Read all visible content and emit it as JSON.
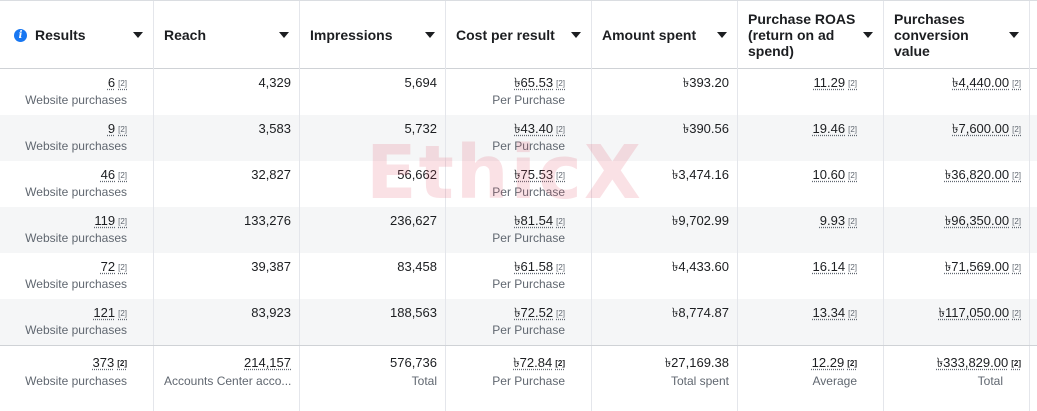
{
  "columns": [
    {
      "key": "results",
      "label": "Results"
    },
    {
      "key": "reach",
      "label": "Reach"
    },
    {
      "key": "impressions",
      "label": "Impressions"
    },
    {
      "key": "cost",
      "label": "Cost per result"
    },
    {
      "key": "spent",
      "label": "Amount spent"
    },
    {
      "key": "roas",
      "label": "Purchase ROAS (return on ad spend)"
    },
    {
      "key": "conv",
      "label": "Purchases conversion value"
    }
  ],
  "footnote": "[2]",
  "rows": [
    {
      "results": "6",
      "results_sub": "Website purchases",
      "reach": "4,329",
      "impressions": "5,694",
      "cost": "৳65.53",
      "cost_sub": "Per Purchase",
      "spent": "৳393.20",
      "roas": "11.29",
      "conv": "৳4,440.00"
    },
    {
      "results": "9",
      "results_sub": "Website purchases",
      "reach": "3,583",
      "impressions": "5,732",
      "cost": "৳43.40",
      "cost_sub": "Per Purchase",
      "spent": "৳390.56",
      "roas": "19.46",
      "conv": "৳7,600.00"
    },
    {
      "results": "46",
      "results_sub": "Website purchases",
      "reach": "32,827",
      "impressions": "56,662",
      "cost": "৳75.53",
      "cost_sub": "Per Purchase",
      "spent": "৳3,474.16",
      "roas": "10.60",
      "conv": "৳36,820.00"
    },
    {
      "results": "119",
      "results_sub": "Website purchases",
      "reach": "133,276",
      "impressions": "236,627",
      "cost": "৳81.54",
      "cost_sub": "Per Purchase",
      "spent": "৳9,702.99",
      "roas": "9.93",
      "conv": "৳96,350.00"
    },
    {
      "results": "72",
      "results_sub": "Website purchases",
      "reach": "39,387",
      "impressions": "83,458",
      "cost": "৳61.58",
      "cost_sub": "Per Purchase",
      "spent": "৳4,433.60",
      "roas": "16.14",
      "conv": "৳71,569.00"
    },
    {
      "results": "121",
      "results_sub": "Website purchases",
      "reach": "83,923",
      "impressions": "188,563",
      "cost": "৳72.52",
      "cost_sub": "Per Purchase",
      "spent": "৳8,774.87",
      "roas": "13.34",
      "conv": "৳117,050.00"
    }
  ],
  "totals": {
    "results": "373",
    "results_sub": "Website purchases",
    "reach": "214,157",
    "reach_sub": "Accounts Center acco...",
    "impressions": "576,736",
    "impressions_sub": "Total",
    "cost": "৳72.84",
    "cost_sub": "Per Purchase",
    "spent": "৳27,169.38",
    "spent_sub": "Total spent",
    "roas": "12.29",
    "roas_sub": "Average",
    "conv": "৳333,829.00",
    "conv_sub": "Total"
  },
  "watermark": "EthicX",
  "colors": {
    "accent": "#1877f2",
    "border": "#e4e6eb",
    "alt_row": "#f5f6f7"
  }
}
